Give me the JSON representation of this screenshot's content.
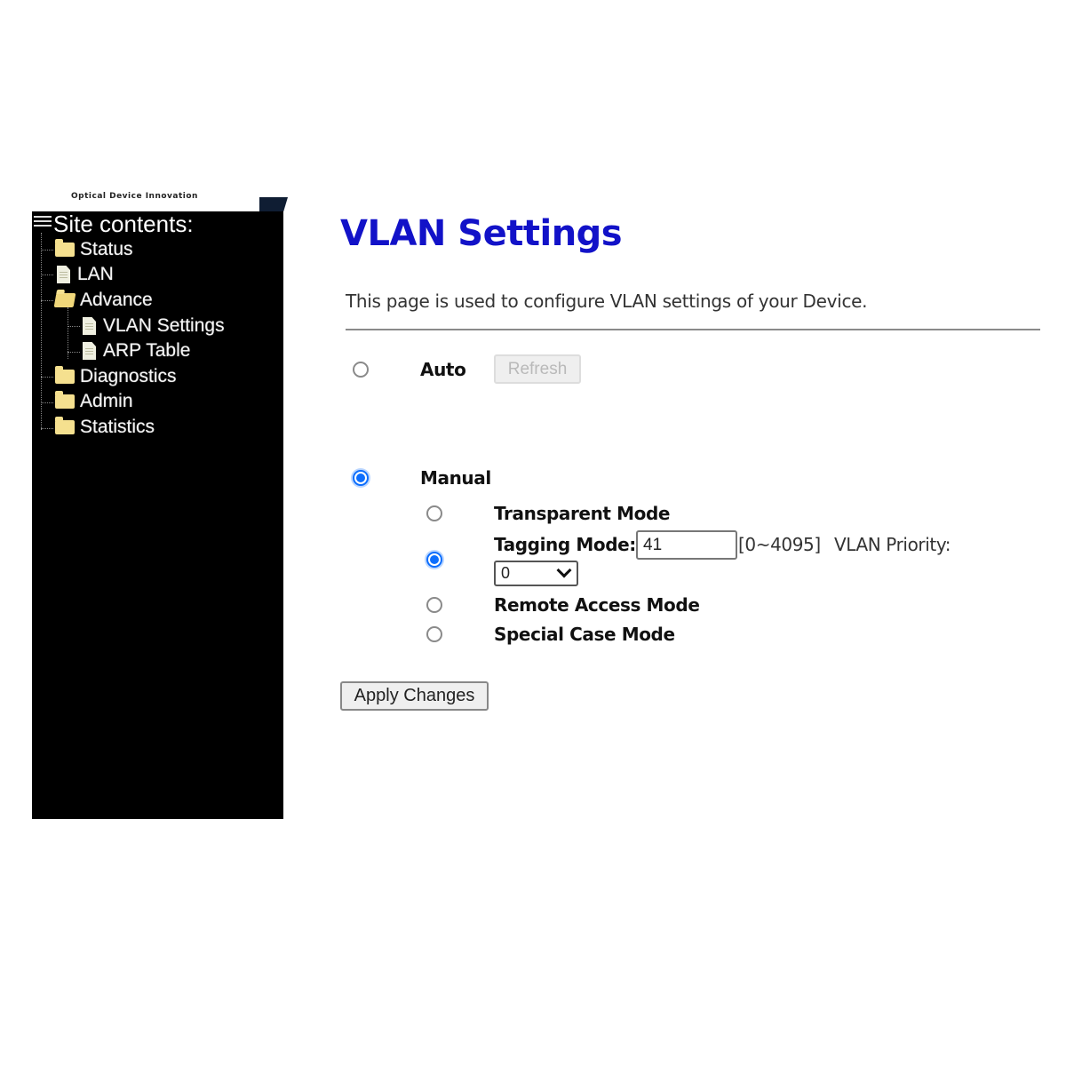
{
  "header": {
    "logo_text": "Optical Device Innovation"
  },
  "sidebar": {
    "title": "Site contents:",
    "items": [
      {
        "label": "Status",
        "icon": "folder-icon"
      },
      {
        "label": "LAN",
        "icon": "document-icon"
      },
      {
        "label": "Advance",
        "icon": "folder-open-icon",
        "children": [
          {
            "label": "VLAN Settings",
            "icon": "document-icon"
          },
          {
            "label": "ARP Table",
            "icon": "document-icon"
          }
        ]
      },
      {
        "label": "Diagnostics",
        "icon": "folder-icon"
      },
      {
        "label": "Admin",
        "icon": "folder-icon"
      },
      {
        "label": "Statistics",
        "icon": "folder-icon"
      }
    ]
  },
  "main": {
    "title": "VLAN Settings",
    "description": "This page is used to configure VLAN settings of your Device.",
    "mode": {
      "auto_label": "Auto",
      "auto_checked": false,
      "refresh_label": "Refresh",
      "manual_label": "Manual",
      "manual_checked": true
    },
    "manual_options": {
      "transparent_label": "Transparent Mode",
      "transparent_checked": false,
      "tagging_label": "Tagging Mode:",
      "tagging_checked": true,
      "vlan_id_value": "41",
      "vlan_id_range": "[0~4095]",
      "priority_label": "VLAN Priority:",
      "priority_value": "0",
      "remote_label": "Remote Access Mode",
      "remote_checked": false,
      "special_label": "Special Case Mode",
      "special_checked": false
    },
    "apply_label": "Apply Changes"
  },
  "colors": {
    "title": "#1212c8",
    "radio_checked": "#0d6efd",
    "sidebar_bg": "#000000"
  }
}
